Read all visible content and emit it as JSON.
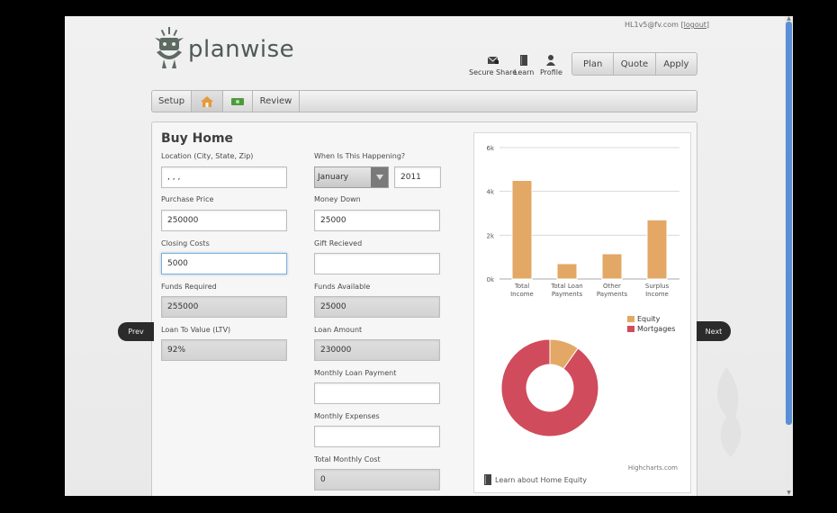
{
  "header": {
    "brand": "planwise",
    "user_email": "HL1v5@fv.com",
    "logout": "logout",
    "icons": [
      {
        "label": "Secure Share",
        "icon": "mail-lock-icon"
      },
      {
        "label": "Learn",
        "icon": "book-icon"
      },
      {
        "label": "Profile",
        "icon": "person-icon"
      }
    ],
    "nav": [
      "Plan",
      "Quote",
      "Apply"
    ]
  },
  "stepbar": {
    "items": [
      {
        "label": "Setup",
        "icon": ""
      },
      {
        "label": "",
        "icon": "home-icon"
      },
      {
        "label": "",
        "icon": "money-icon"
      },
      {
        "label": "Review",
        "icon": ""
      }
    ]
  },
  "form": {
    "title": "Buy Home",
    "location_label": "Location (City, State, Zip)",
    "location_value": ", , ,",
    "when_label": "When Is This Happening?",
    "month": "January",
    "year": "2011",
    "purchase_price_label": "Purchase Price",
    "purchase_price": "250000",
    "money_down_label": "Money Down",
    "money_down": "25000",
    "closing_costs_label": "Closing Costs",
    "closing_costs": "5000",
    "gift_label": "Gift Recieved",
    "gift": "",
    "funds_required_label": "Funds Required",
    "funds_required": "255000",
    "funds_available_label": "Funds Available",
    "funds_available": "25000",
    "ltv_label": "Loan To Value (LTV)",
    "ltv": "92%",
    "loan_amount_label": "Loan Amount",
    "loan_amount": "230000",
    "monthly_payment_label": "Monthly Loan Payment",
    "monthly_payment": "",
    "monthly_expenses_label": "Monthly Expenses",
    "monthly_expenses": "",
    "total_monthly_label": "Total Monthly Cost",
    "total_monthly": "0"
  },
  "chart_data": [
    {
      "type": "bar",
      "categories": [
        "Total Income",
        "Total Loan Payments",
        "Other Payments",
        "Surplus Income"
      ],
      "values": [
        4500,
        700,
        1150,
        2700
      ],
      "ylim": [
        0,
        6000
      ],
      "yticks": [
        "0k",
        "2k",
        "4k",
        "6k"
      ],
      "grid": true,
      "color": "#e3a865"
    },
    {
      "type": "pie",
      "donut": true,
      "legend": [
        "Equity",
        "Mortgages"
      ],
      "values": [
        25000,
        230000
      ],
      "colors": [
        "#e3a865",
        "#d04b5c"
      ],
      "legend_position": "top-right"
    }
  ],
  "chart_card": {
    "credits": "Highcharts.com",
    "learn_link": "Learn about Home Equity"
  },
  "pager": {
    "prev": "Prev",
    "next": "Next"
  },
  "colors": {
    "accent": "#5a8fd6",
    "bar": "#e3a865",
    "mortgage": "#d04b5c"
  }
}
